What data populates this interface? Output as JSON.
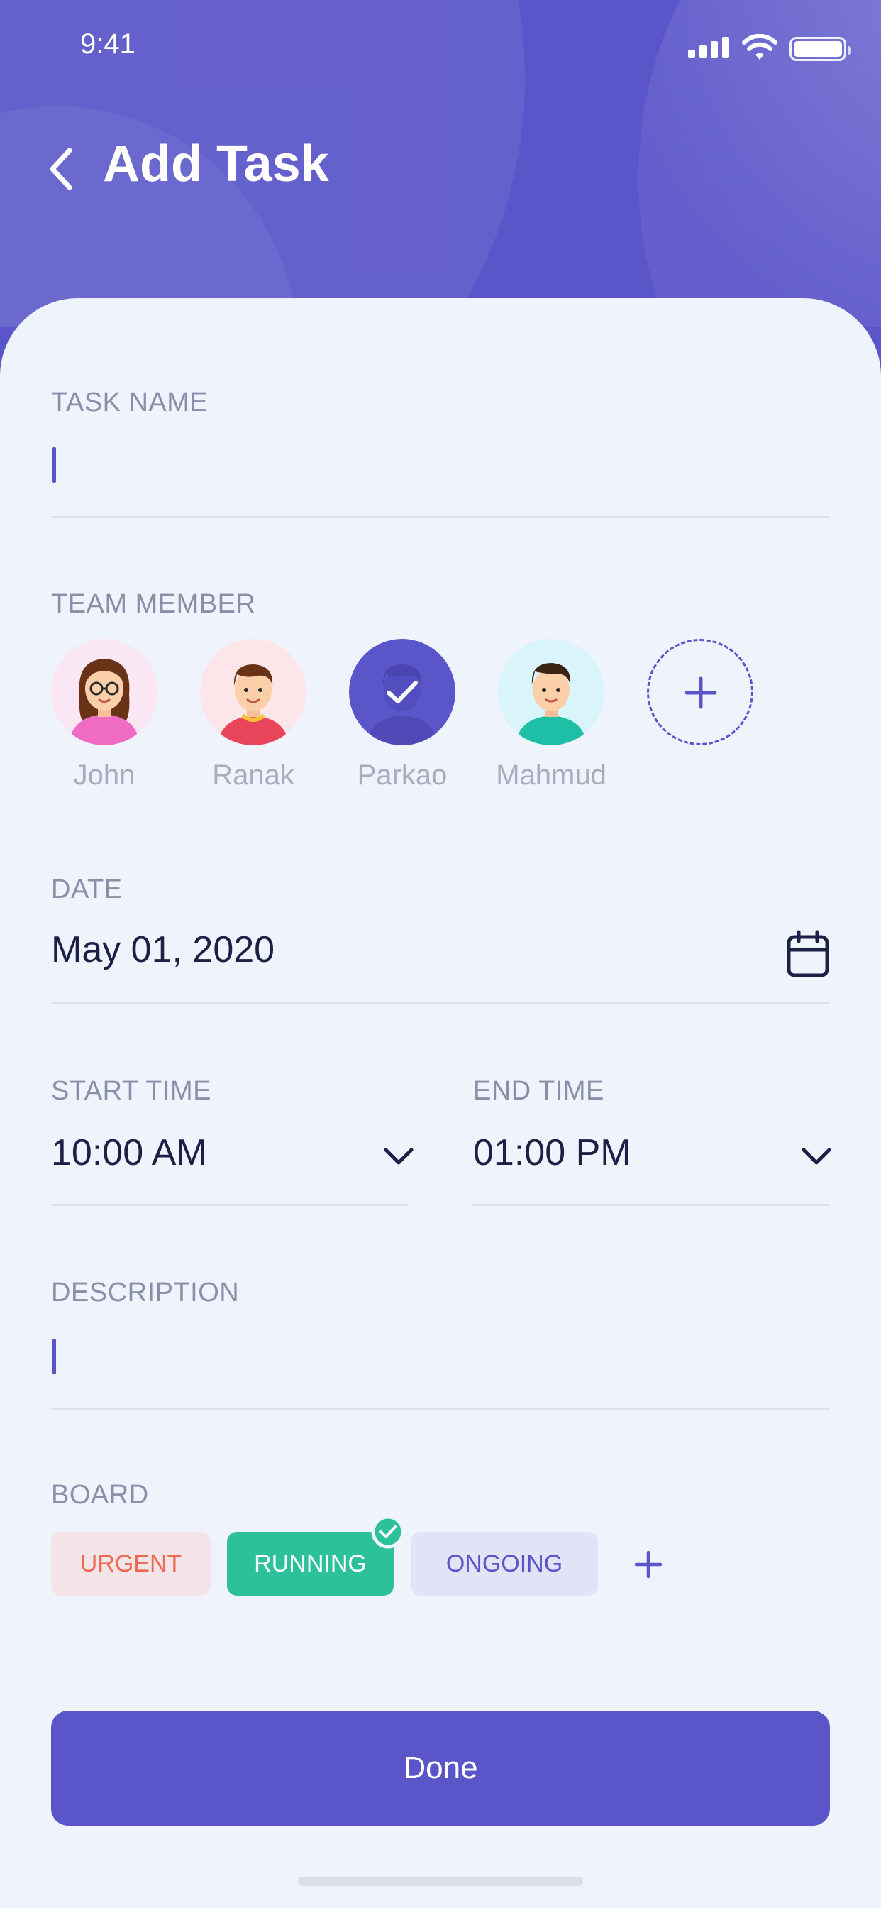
{
  "status_bar": {
    "time": "9:41"
  },
  "header": {
    "title": "Add Task"
  },
  "form": {
    "task_name": {
      "label": "TASK NAME",
      "value": ""
    },
    "team_member": {
      "label": "TEAM MEMBER",
      "members": [
        {
          "name": "John",
          "selected": false
        },
        {
          "name": "Ranak",
          "selected": false
        },
        {
          "name": "Parkao",
          "selected": true
        },
        {
          "name": "Mahmud",
          "selected": false
        }
      ]
    },
    "date": {
      "label": "DATE",
      "value": "May 01, 2020"
    },
    "start_time": {
      "label": "START TIME",
      "value": "10:00 AM"
    },
    "end_time": {
      "label": "END TIME",
      "value": "01:00 PM"
    },
    "description": {
      "label": "DESCRIPTION",
      "value": ""
    },
    "board": {
      "label": "BOARD",
      "options": [
        {
          "label": "URGENT",
          "selected": false,
          "color": "#ec6a4f",
          "bg": "#f2e4e8"
        },
        {
          "label": "RUNNING",
          "selected": true,
          "color": "#ffffff",
          "bg": "#2dc19b"
        },
        {
          "label": "ONGOING",
          "selected": false,
          "color": "#5a55c9",
          "bg": "#e2e3f6"
        }
      ]
    }
  },
  "actions": {
    "done_label": "Done"
  },
  "colors": {
    "primary": "#5a55c9",
    "background": "#eff3fb",
    "success": "#2dc19b"
  }
}
